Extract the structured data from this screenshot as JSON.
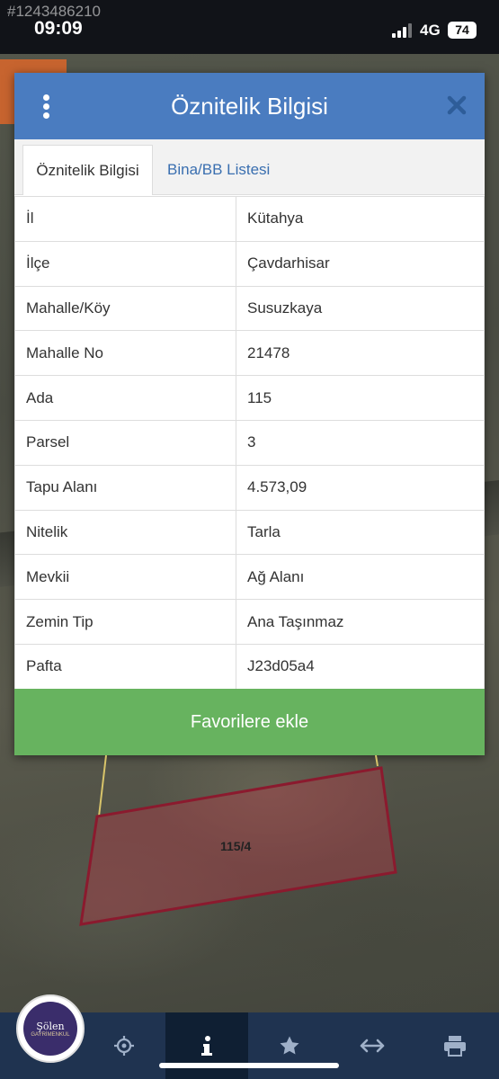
{
  "overlay": {
    "watermark_id": "#1243486210"
  },
  "status_bar": {
    "time": "09:09",
    "network": "4G",
    "battery": "74"
  },
  "modal": {
    "title": "Öznitelik Bilgisi",
    "tabs": [
      {
        "label": "Öznitelik Bilgisi",
        "active": true
      },
      {
        "label": "Bina/BB Listesi",
        "active": false
      }
    ],
    "rows": [
      {
        "key": "İl",
        "value": "Kütahya"
      },
      {
        "key": "İlçe",
        "value": "Çavdarhisar"
      },
      {
        "key": "Mahalle/Köy",
        "value": "Susuzkaya"
      },
      {
        "key": "Mahalle No",
        "value": "21478"
      },
      {
        "key": "Ada",
        "value": "115"
      },
      {
        "key": "Parsel",
        "value": "3"
      },
      {
        "key": "Tapu Alanı",
        "value": "4.573,09"
      },
      {
        "key": "Nitelik",
        "value": "Tarla"
      },
      {
        "key": "Mevkii",
        "value": "Ağ Alanı"
      },
      {
        "key": "Zemin Tip",
        "value": "Ana Taşınmaz"
      },
      {
        "key": "Pafta",
        "value": "J23d05a4"
      }
    ],
    "favorite_button": "Favorilere ekle"
  },
  "map": {
    "parcel_label": "115/4"
  },
  "logo": {
    "name": "Şölen",
    "tagline": "GAYRİMENKUL"
  },
  "bottom_nav": {
    "items": [
      {
        "icon": "locate-icon",
        "active": false
      },
      {
        "icon": "info-icon",
        "active": true
      },
      {
        "icon": "star-icon",
        "active": false
      },
      {
        "icon": "measure-icon",
        "active": false
      },
      {
        "icon": "print-icon",
        "active": false
      }
    ]
  },
  "colors": {
    "header": "#4a7cc0",
    "button": "#67b35f",
    "nav": "#1f3350",
    "parcel": "#8b1a2e"
  }
}
